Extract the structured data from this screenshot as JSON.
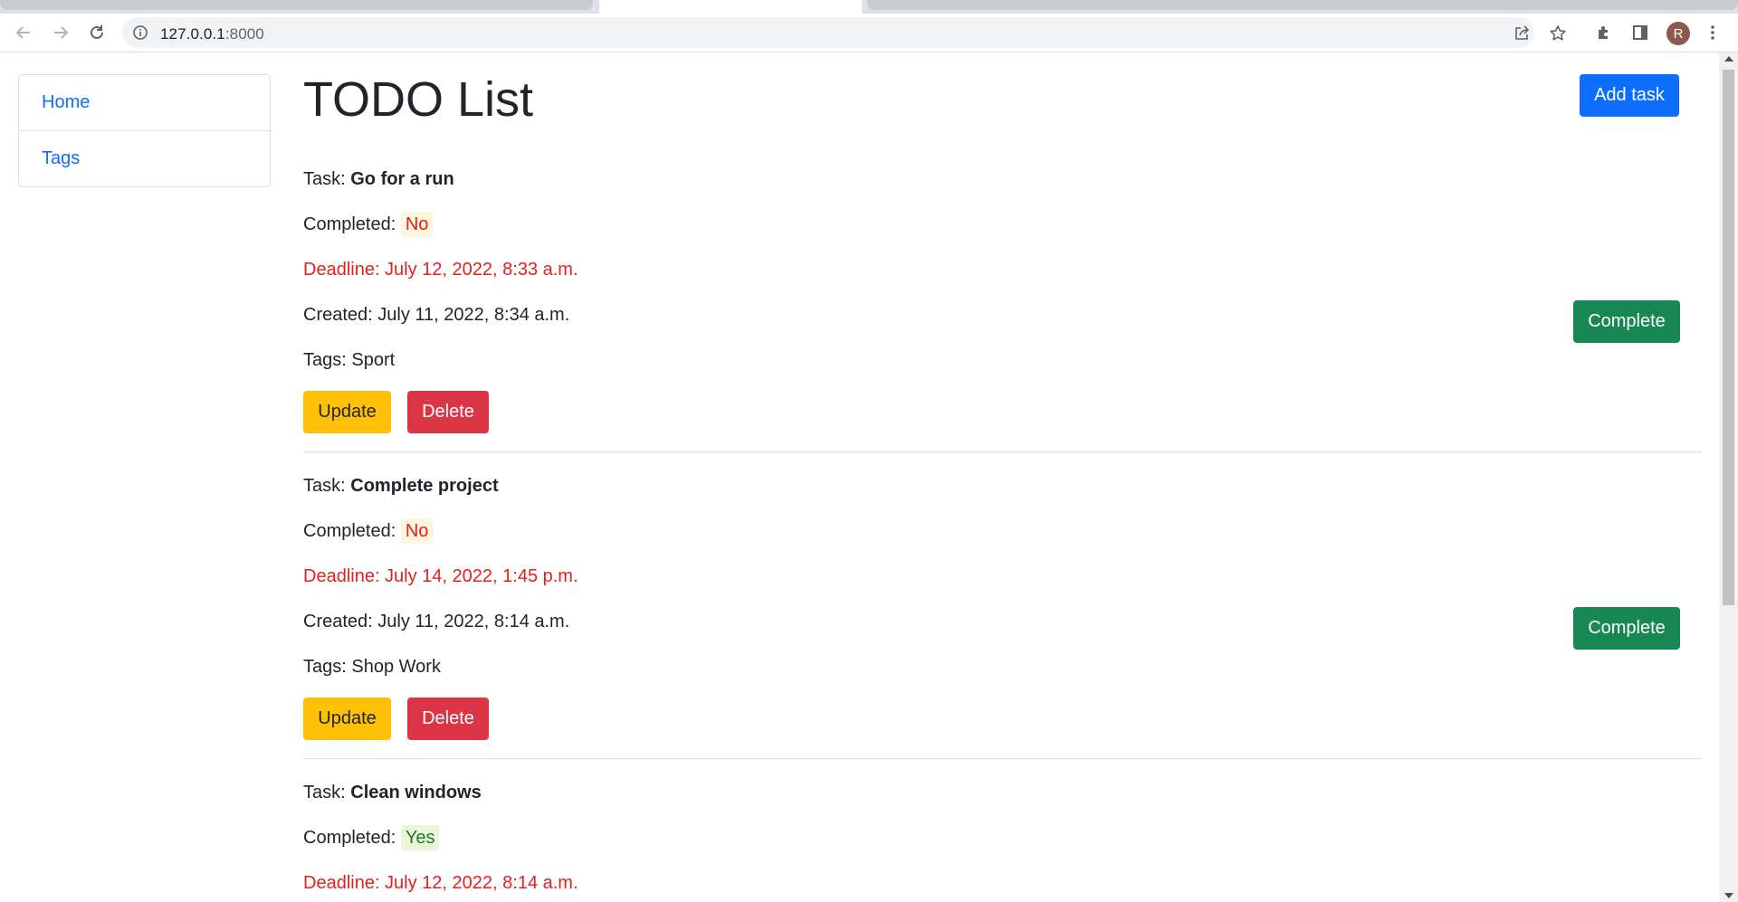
{
  "browser": {
    "url_host": "127.0.0.1",
    "url_port": ":8000",
    "avatar_letter": "R"
  },
  "sidebar": {
    "items": [
      {
        "label": "Home"
      },
      {
        "label": "Tags"
      }
    ]
  },
  "main": {
    "title": "TODO List",
    "add_task_label": "Add task",
    "task_prefix": "Task:",
    "completed_prefix": "Completed:",
    "created_prefix": "Created:",
    "tags_prefix": "Tags:",
    "complete_label": "Complete",
    "update_label": "Update",
    "delete_label": "Delete",
    "tasks": [
      {
        "name": "Go for a run",
        "completed": "No",
        "deadline": "Deadline: July 12, 2022, 8:33 a.m.",
        "created": "July 11, 2022, 8:34 a.m.",
        "tags": "Sport"
      },
      {
        "name": "Complete project",
        "completed": "No",
        "deadline": "Deadline: July 14, 2022, 1:45 p.m.",
        "created": "July 11, 2022, 8:14 a.m.",
        "tags": "Shop Work"
      },
      {
        "name": "Clean windows",
        "completed": "Yes",
        "deadline": "Deadline: July 12, 2022, 8:14 a.m."
      }
    ]
  },
  "colors": {
    "primary": "#0d6efd",
    "success": "#198754",
    "warning": "#ffc107",
    "danger": "#dc3545",
    "deadline_text": "#e41f1f"
  }
}
